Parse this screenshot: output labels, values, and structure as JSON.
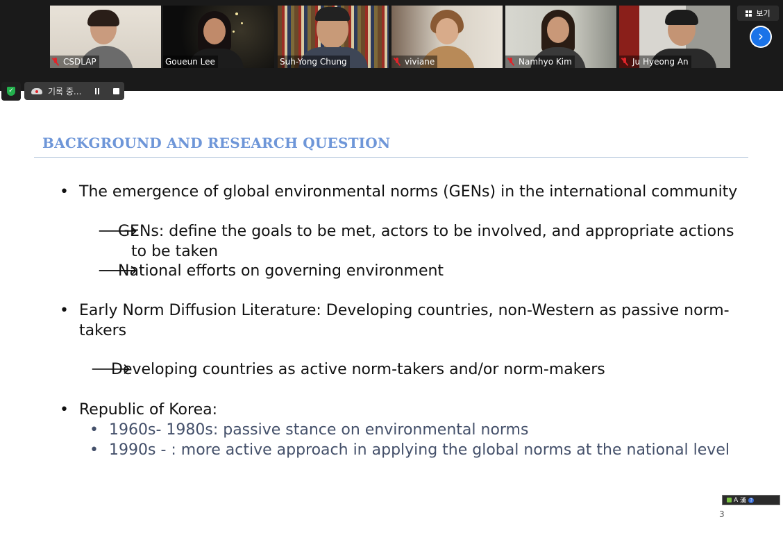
{
  "participants": [
    {
      "name": "CSDLAP",
      "muted": true
    },
    {
      "name": "Goueun Lee",
      "muted": false,
      "active": true
    },
    {
      "name": "Suh-Yong Chung",
      "muted": false
    },
    {
      "name": "viviane",
      "muted": true
    },
    {
      "name": "Namhyo Kim",
      "muted": true
    },
    {
      "name": "Ju Hyeong An",
      "muted": true
    }
  ],
  "toolbar": {
    "view_label": "보기",
    "recording_label": "기록 중..."
  },
  "slide": {
    "title": "BACKGROUND AND RESEARCH QUESTION",
    "b1": "The emergence of global environmental norms (GENs) in the international community",
    "b1_arrow1_line1": "GENs: define the goals to be met, actors to be involved, and appropriate actions",
    "b1_arrow1_line2": "to be taken",
    "b1_arrow2": "National efforts on governing environment",
    "b2_line1": "Early Norm Diffusion Literature: Developing countries, non-Western as passive norm-",
    "b2_line2": "takers",
    "b2_arrow": "Developing countries as active norm-takers and/or norm-makers",
    "b3": "Republic of Korea:",
    "b3_sub1": "1960s- 1980s: passive stance on environmental norms",
    "b3_sub2": "1990s - : more active approach in applying the global norms at the national level",
    "bullet_glyph": "•",
    "arrow_glyph": "🡒",
    "page_number": "3"
  },
  "ime": {
    "mode": "A",
    "hanja": "漢"
  },
  "colors": {
    "title": "#6e96d8",
    "active_border": "#c9e26a",
    "next_button": "#1a73e8"
  }
}
